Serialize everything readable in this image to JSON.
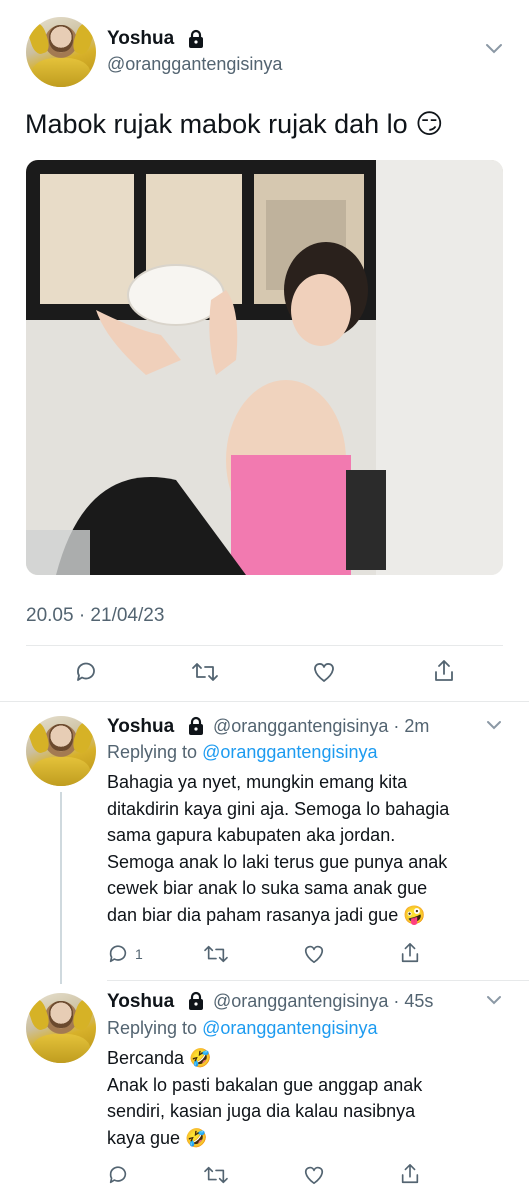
{
  "main_tweet": {
    "author_name": "Yoshua",
    "author_handle": "@oranggantengisinya",
    "text": "Mabok rujak mabok rujak dah lo 😏",
    "timestamp": "20.05 · 21/04/23"
  },
  "replies": [
    {
      "author_name": "Yoshua",
      "handle_time": "@oranggantengisinya · 2m",
      "replying_label": "Replying to",
      "replying_handle": "@oranggantengisinya",
      "lines": [
        "Bahagia ya nyet, mungkin emang kita",
        "ditakdirin kaya gini aja. Semoga lo bahagia",
        "sama gapura kabupaten aka jordan.",
        "Semoga anak lo laki terus gue punya anak",
        "cewek biar anak lo suka sama anak gue",
        "dan biar dia paham rasanya jadi gue 🤪"
      ],
      "reply_count": "1"
    },
    {
      "author_name": "Yoshua",
      "handle_time": "@oranggantengisinya · 45s",
      "replying_label": "Replying to",
      "replying_handle": "@oranggantengisinya",
      "lines": [
        "Bercanda 🤣",
        "Anak lo pasti bakalan gue anggap anak",
        "sendiri, kasian juga dia kalau nasibnya",
        "kaya gue 🤣"
      ]
    }
  ],
  "colors": {
    "accent": "#1d9bf0",
    "secondary_text": "#536471",
    "divider": "#e7e9ea"
  },
  "icons": [
    "lock-icon",
    "chevron-down-icon",
    "reply-icon",
    "retweet-icon",
    "like-icon",
    "share-icon"
  ]
}
